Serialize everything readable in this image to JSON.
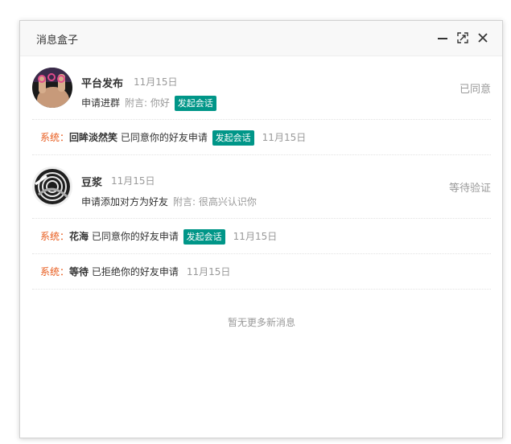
{
  "window": {
    "title": "消息盒子",
    "controls": {
      "minimize_icon": "minimize-icon",
      "maximize_icon": "maximize-icon",
      "close_icon": "close-icon"
    }
  },
  "messages": [
    {
      "type": "user",
      "name": "平台发布",
      "date": "11月15日",
      "action": "申请进群",
      "note": "附言: 你好",
      "button": "发起会话",
      "status": "已同意"
    },
    {
      "type": "system",
      "label": "系统：",
      "name": "回眸淡然笑",
      "text": " 已同意你的好友申请 ",
      "button": "发起会话",
      "date": "11月15日"
    },
    {
      "type": "user",
      "name": "豆浆",
      "date": "11月15日",
      "action": "申请添加对方为好友",
      "note": "附言: 很高兴认识你",
      "status": "等待验证"
    },
    {
      "type": "system",
      "label": "系统：",
      "name": "花海",
      "text": " 已同意你的好友申请 ",
      "button": "发起会话",
      "date": "11月15日"
    },
    {
      "type": "system",
      "label": "系统：",
      "name": "等待",
      "text": " 已拒绝你的好友申请",
      "date": "11月15日"
    }
  ],
  "footer": {
    "no_more": "暂无更多新消息"
  },
  "colors": {
    "accent": "#009688",
    "system_label": "#e85c1e",
    "muted": "#999999"
  }
}
